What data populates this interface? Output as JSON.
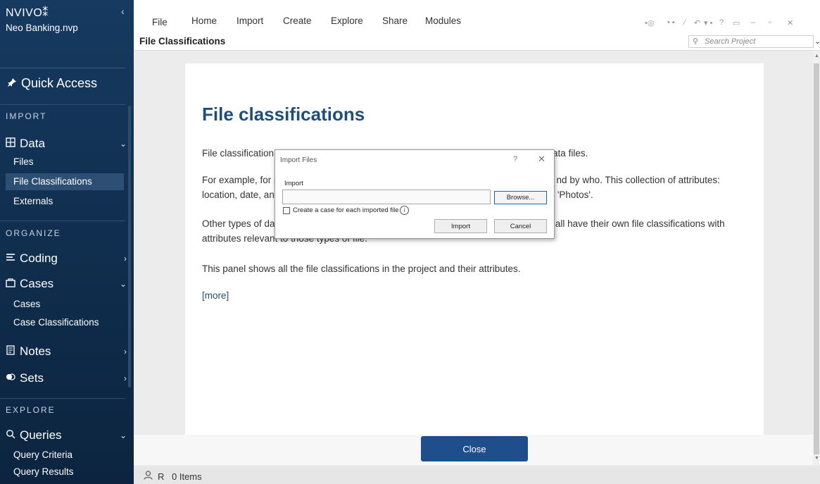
{
  "sidebar": {
    "brand": "NVIVO",
    "brand_mark": "⁑",
    "collapse": "‹",
    "project": "Neo Banking.nvp",
    "quick_access": "Quick Access",
    "sections": {
      "import": "IMPORT",
      "organize": "ORGANIZE",
      "explore": "EXPLORE"
    },
    "data": {
      "label": "Data",
      "items": [
        "Files",
        "File Classifications",
        "Externals"
      ]
    },
    "coding": {
      "label": "Coding"
    },
    "cases": {
      "label": "Cases",
      "items": [
        "Cases",
        "Case Classifications"
      ]
    },
    "notes": {
      "label": "Notes"
    },
    "sets": {
      "label": "Sets"
    },
    "queries": {
      "label": "Queries",
      "items": [
        "Query Criteria",
        "Query Results"
      ]
    }
  },
  "menu": [
    "File",
    "Home",
    "Import",
    "Create",
    "Explore",
    "Share",
    "Modules"
  ],
  "header": {
    "title": "File Classifications",
    "search_placeholder": "Search Project"
  },
  "content": {
    "heading": "File classifications",
    "p1_a": "File classification",
    "p1_b": "ata files.",
    "p2_a": "For example, for p",
    "p2_b": "nd by who. This collection of attributes:",
    "p2_c": "location, date, an",
    "p2_d": "'Photos'.",
    "p3_a": "Other types of da",
    "p3_b": "n all have their own file classifications with",
    "p3_c": "attributes relevant to those types of file.",
    "p4": "This panel shows all the file classifications in the project and their attributes.",
    "more": "[more]"
  },
  "close_label": "Close",
  "status": {
    "user": "R",
    "items": "0 Items"
  },
  "dialog": {
    "title": "Import Files",
    "help": "?",
    "close": "X",
    "import_label": "Import",
    "input_value": "",
    "browse": "Browse...",
    "checkbox_label": "Create a case for each imported file",
    "info": "i",
    "import_button": "Import",
    "cancel_button": "Cancel"
  },
  "colors": {
    "sidebar": "#163a60",
    "accent": "#1f4e79",
    "close_button": "#1f4e8c"
  }
}
